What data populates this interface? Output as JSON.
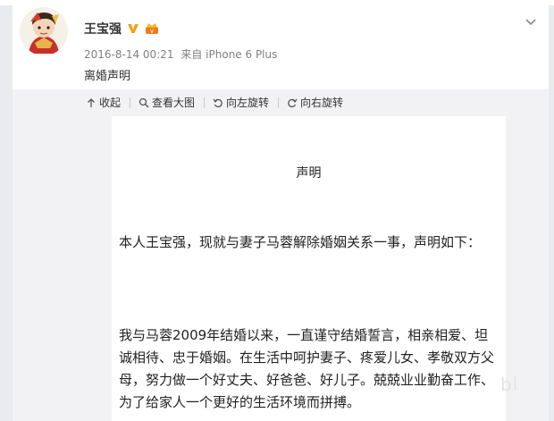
{
  "post": {
    "author": "王宝强",
    "date": "2016-8-14 00:21",
    "source_prefix": "来自",
    "device": "iPhone 6 Plus",
    "text": "离婚声明"
  },
  "toolbar": {
    "collapse_label": "收起",
    "view_large_label": "查看大图",
    "rotate_left_label": "向左旋转",
    "rotate_right_label": "向右旋转"
  },
  "document": {
    "title": "声明",
    "paragraph1": "本人王宝强，现就与妻子马蓉解除婚姻关系一事，声明如下：",
    "paragraph2": "我与马蓉2009年结婚以来，一直谨守结婚誓言，相亲相爱、坦诚相待、忠于婚姻。在生活中呵护妻子、疼爱儿女、孝敬双方父母，努力做一个好丈夫、好爸爸、好儿子。兢兢业业勤奋工作、为了给家人一个更好的生活环境而拼搏。"
  },
  "watermark": "bl",
  "colors": {
    "verified_badge": "#f3a20f",
    "vip_badge": "#f07a1a",
    "toolbar_bg": "#f2f2f5"
  },
  "icons": [
    "avatar",
    "verified-v-icon",
    "vip-crown-icon",
    "more-chevron-icon",
    "collapse-icon",
    "magnifier-icon",
    "rotate-left-icon",
    "rotate-right-icon"
  ]
}
